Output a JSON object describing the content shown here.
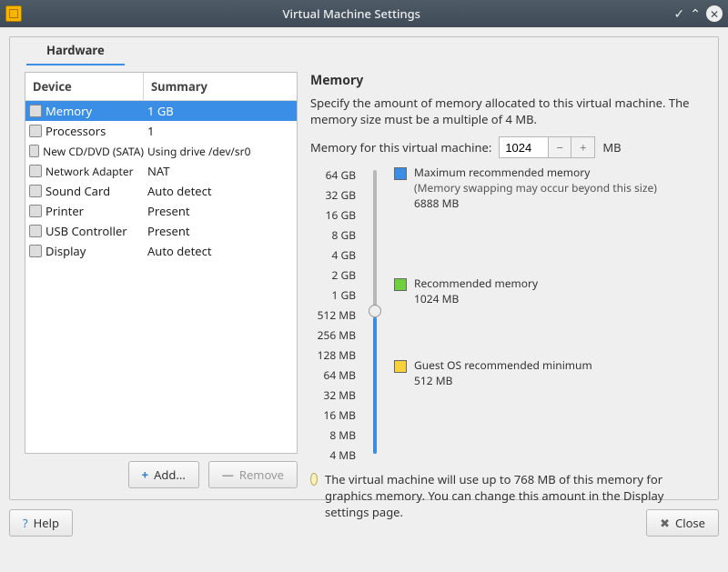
{
  "window": {
    "title": "Virtual Machine Settings"
  },
  "tab": {
    "hardware": "Hardware"
  },
  "device_table": {
    "headers": {
      "device": "Device",
      "summary": "Summary"
    },
    "rows": [
      {
        "name": "Memory",
        "summary": "1 GB",
        "selected": true
      },
      {
        "name": "Processors",
        "summary": "1"
      },
      {
        "name": "New CD/DVD (SATA)",
        "summary": "Using drive /dev/sr0"
      },
      {
        "name": "Network Adapter",
        "summary": "NAT"
      },
      {
        "name": "Sound Card",
        "summary": "Auto detect"
      },
      {
        "name": "Printer",
        "summary": "Present"
      },
      {
        "name": "USB Controller",
        "summary": "Present"
      },
      {
        "name": "Display",
        "summary": "Auto detect"
      }
    ],
    "buttons": {
      "add": "Add...",
      "remove": "Remove"
    }
  },
  "memory": {
    "heading": "Memory",
    "description": "Specify the amount of memory allocated to this virtual machine. The memory size must be a multiple of 4 MB.",
    "field_label": "Memory for this virtual machine:",
    "value": "1024",
    "unit": "MB",
    "ticks": [
      "64 GB",
      "32 GB",
      "16 GB",
      "8 GB",
      "4 GB",
      "2 GB",
      "1 GB",
      "512 MB",
      "256 MB",
      "128 MB",
      "64 MB",
      "32 MB",
      "16 MB",
      "8 MB",
      "4 MB"
    ],
    "max": {
      "label": "Maximum recommended memory",
      "note": "(Memory swapping may occur beyond this size)",
      "value": "6888 MB"
    },
    "rec": {
      "label": "Recommended memory",
      "value": "1024 MB"
    },
    "min": {
      "label": "Guest OS recommended minimum",
      "value": "512 MB"
    },
    "hint": "The virtual machine will use up to 768 MB of this memory for graphics memory. You can change this amount in the Display settings page."
  },
  "footer": {
    "help": "Help",
    "close": "Close"
  }
}
